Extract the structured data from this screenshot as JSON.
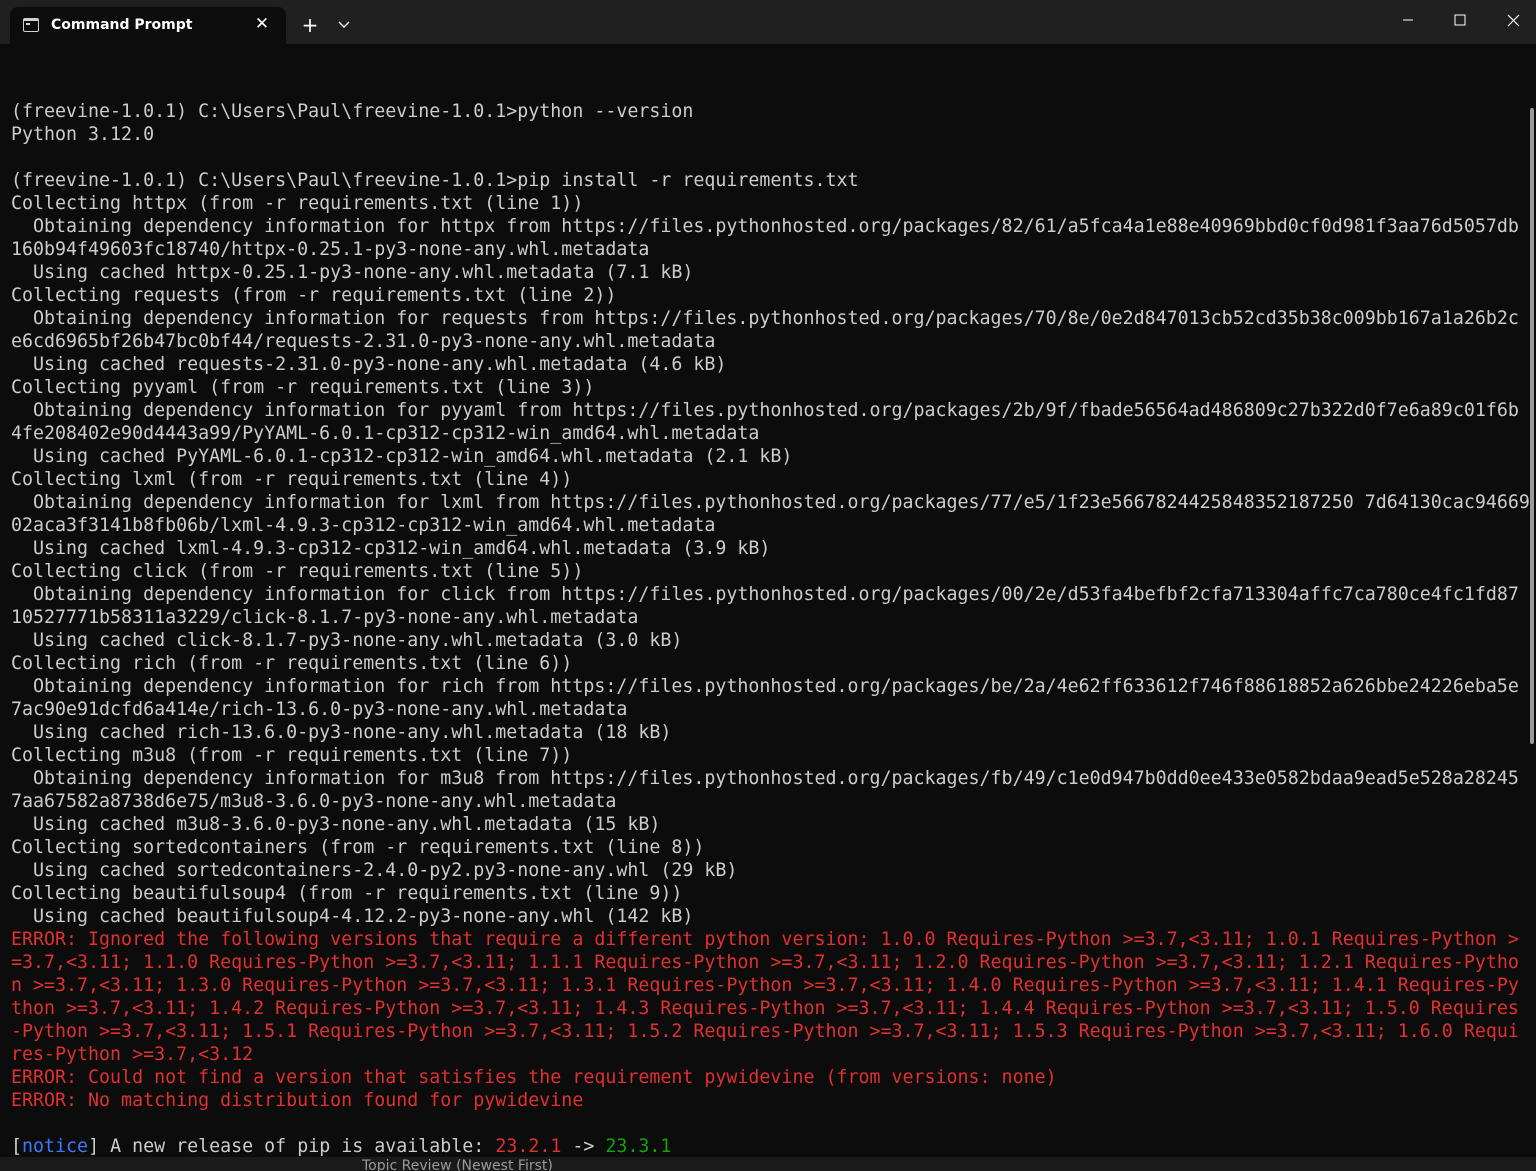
{
  "window": {
    "tab_title": "Command Prompt",
    "tab_icon": "cmd-icon",
    "close_tab_glyph": "✕",
    "new_tab_glyph": "+",
    "minimize_icon": "minimize-icon",
    "maximize_icon": "maximize-icon",
    "close_icon": "close-icon"
  },
  "terminal": {
    "lines": [
      {
        "text": "",
        "style": "normal"
      },
      {
        "text": "(freevine-1.0.1) C:\\Users\\Paul\\freevine-1.0.1>python --version",
        "style": "normal"
      },
      {
        "text": "Python 3.12.0",
        "style": "normal"
      },
      {
        "text": "",
        "style": "normal"
      },
      {
        "text": "(freevine-1.0.1) C:\\Users\\Paul\\freevine-1.0.1>pip install -r requirements.txt",
        "style": "normal"
      },
      {
        "text": "Collecting httpx (from -r requirements.txt (line 1))",
        "style": "normal"
      },
      {
        "text": "  Obtaining dependency information for httpx from https://files.pythonhosted.org/packages/82/61/a5fca4a1e88e40969bbd0cf0d981f3aa76d5057db",
        "style": "normal"
      },
      {
        "text": "160b94f49603fc18740/httpx-0.25.1-py3-none-any.whl.metadata",
        "style": "normal"
      },
      {
        "text": "  Using cached httpx-0.25.1-py3-none-any.whl.metadata (7.1 kB)",
        "style": "normal"
      },
      {
        "text": "Collecting requests (from -r requirements.txt (line 2))",
        "style": "normal"
      },
      {
        "text": "  Obtaining dependency information for requests from https://files.pythonhosted.org/packages/70/8e/0e2d847013cb52cd35b38c009bb167a1a26b2c",
        "style": "normal"
      },
      {
        "text": "e6cd6965bf26b47bc0bf44/requests-2.31.0-py3-none-any.whl.metadata",
        "style": "normal"
      },
      {
        "text": "  Using cached requests-2.31.0-py3-none-any.whl.metadata (4.6 kB)",
        "style": "normal"
      },
      {
        "text": "Collecting pyyaml (from -r requirements.txt (line 3))",
        "style": "normal"
      },
      {
        "text": "  Obtaining dependency information for pyyaml from https://files.pythonhosted.org/packages/2b/9f/fbade56564ad486809c27b322d0f7e6a89c01f6b",
        "style": "normal"
      },
      {
        "text": "4fe208402e90d4443a99/PyYAML-6.0.1-cp312-cp312-win_amd64.whl.metadata",
        "style": "normal"
      },
      {
        "text": "  Using cached PyYAML-6.0.1-cp312-cp312-win_amd64.whl.metadata (2.1 kB)",
        "style": "normal"
      },
      {
        "text": "Collecting lxml (from -r requirements.txt (line 4))",
        "style": "normal"
      },
      {
        "text": "  Obtaining dependency information for lxml from https://files.pythonhosted.org/packages/77/e5/1f23e5667824425848352187250 7d64130cac94669",
        "style": "normal"
      },
      {
        "text": "02aca3f3141b8fb06b/lxml-4.9.3-cp312-cp312-win_amd64.whl.metadata",
        "style": "normal"
      },
      {
        "text": "  Using cached lxml-4.9.3-cp312-cp312-win_amd64.whl.metadata (3.9 kB)",
        "style": "normal"
      },
      {
        "text": "Collecting click (from -r requirements.txt (line 5))",
        "style": "normal"
      },
      {
        "text": "  Obtaining dependency information for click from https://files.pythonhosted.org/packages/00/2e/d53fa4befbf2cfa713304affc7ca780ce4fc1fd87",
        "style": "normal"
      },
      {
        "text": "10527771b58311a3229/click-8.1.7-py3-none-any.whl.metadata",
        "style": "normal"
      },
      {
        "text": "  Using cached click-8.1.7-py3-none-any.whl.metadata (3.0 kB)",
        "style": "normal"
      },
      {
        "text": "Collecting rich (from -r requirements.txt (line 6))",
        "style": "normal"
      },
      {
        "text": "  Obtaining dependency information for rich from https://files.pythonhosted.org/packages/be/2a/4e62ff633612f746f88618852a626bbe24226eba5e",
        "style": "normal"
      },
      {
        "text": "7ac90e91dcfd6a414e/rich-13.6.0-py3-none-any.whl.metadata",
        "style": "normal"
      },
      {
        "text": "  Using cached rich-13.6.0-py3-none-any.whl.metadata (18 kB)",
        "style": "normal"
      },
      {
        "text": "Collecting m3u8 (from -r requirements.txt (line 7))",
        "style": "normal"
      },
      {
        "text": "  Obtaining dependency information for m3u8 from https://files.pythonhosted.org/packages/fb/49/c1e0d947b0dd0ee433e0582bdaa9ead5e528a28245",
        "style": "normal"
      },
      {
        "text": "7aa67582a8738d6e75/m3u8-3.6.0-py3-none-any.whl.metadata",
        "style": "normal"
      },
      {
        "text": "  Using cached m3u8-3.6.0-py3-none-any.whl.metadata (15 kB)",
        "style": "normal"
      },
      {
        "text": "Collecting sortedcontainers (from -r requirements.txt (line 8))",
        "style": "normal"
      },
      {
        "text": "  Using cached sortedcontainers-2.4.0-py2.py3-none-any.whl (29 kB)",
        "style": "normal"
      },
      {
        "text": "Collecting beautifulsoup4 (from -r requirements.txt (line 9))",
        "style": "normal"
      },
      {
        "text": "  Using cached beautifulsoup4-4.12.2-py3-none-any.whl (142 kB)",
        "style": "normal"
      },
      {
        "text": "ERROR: Ignored the following versions that require a different python version: 1.0.0 Requires-Python >=3.7,<3.11; 1.0.1 Requires-Python >",
        "style": "error"
      },
      {
        "text": "=3.7,<3.11; 1.1.0 Requires-Python >=3.7,<3.11; 1.1.1 Requires-Python >=3.7,<3.11; 1.2.0 Requires-Python >=3.7,<3.11; 1.2.1 Requires-Pytho",
        "style": "error"
      },
      {
        "text": "n >=3.7,<3.11; 1.3.0 Requires-Python >=3.7,<3.11; 1.3.1 Requires-Python >=3.7,<3.11; 1.4.0 Requires-Python >=3.7,<3.11; 1.4.1 Requires-Py",
        "style": "error"
      },
      {
        "text": "thon >=3.7,<3.11; 1.4.2 Requires-Python >=3.7,<3.11; 1.4.3 Requires-Python >=3.7,<3.11; 1.4.4 Requires-Python >=3.7,<3.11; 1.5.0 Requires",
        "style": "error"
      },
      {
        "text": "-Python >=3.7,<3.11; 1.5.1 Requires-Python >=3.7,<3.11; 1.5.2 Requires-Python >=3.7,<3.11; 1.5.3 Requires-Python >=3.7,<3.11; 1.6.0 Requi",
        "style": "error"
      },
      {
        "text": "res-Python >=3.7,<3.12",
        "style": "error"
      },
      {
        "text": "ERROR: Could not find a version that satisfies the requirement pywidevine (from versions: none)",
        "style": "error"
      },
      {
        "text": "ERROR: No matching distribution found for pywidevine",
        "style": "error"
      },
      {
        "text": "",
        "style": "normal"
      }
    ],
    "notice": {
      "open_bracket": "[",
      "word": "notice",
      "close_bracket": "]",
      "message": " A new release of pip is available: ",
      "old_version": "23.2.1",
      "arrow": " -> ",
      "new_version": "23.3.1"
    }
  },
  "background_window_text": "Topic Review (Newest First)",
  "colors": {
    "terminal_bg": "#0c0c0c",
    "text": "#cccccc",
    "error": "#e03030",
    "notice": "#3b78ff",
    "new_version": "#13a10e"
  }
}
